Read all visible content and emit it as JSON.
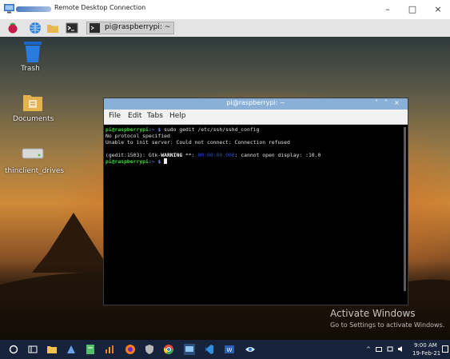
{
  "rdp": {
    "title": "Remote Desktop Connection",
    "minimize": "–",
    "maximize": "□",
    "close": "×"
  },
  "pi_taskbar": {
    "task_label": "pi@raspberrypi: ~"
  },
  "desktop": {
    "icons": [
      {
        "label": "Trash"
      },
      {
        "label": "Documents"
      },
      {
        "label": "thinclient_drives"
      }
    ],
    "activate_title": "Activate Windows",
    "activate_sub": "Go to Settings to activate Windows."
  },
  "terminal": {
    "title": "pi@raspberrypi: ~",
    "controls": [
      "˅",
      "˄",
      "×"
    ],
    "menu": [
      "File",
      "Edit",
      "Tabs",
      "Help"
    ],
    "lines": {
      "l1_prompt": "pi@raspberrypi",
      "l1_path": ":~ $",
      "l1_cmd": " sudo gedit /etc/ssh/sshd_config",
      "l2": "No protocol specified",
      "l3": "Unable to init server: Could not connect: Connection refused",
      "l4_a": "(gedit:1503): Gtk-",
      "l4_warn": "WARNING",
      "l4_b": " **: ",
      "l4_masked": "00:00:00.000",
      "l4_c": ": cannot open display: :10.0",
      "l5_prompt": "pi@raspberrypi",
      "l5_path": ":~ $"
    }
  },
  "win_taskbar": {
    "time": "9:00 AM",
    "date": "19-Feb-21"
  },
  "colors": {
    "prompt": "#3fd93f",
    "path": "#6a8cff",
    "terminal_title": "#8ab0d8",
    "windows_taskbar": "#16233a"
  }
}
